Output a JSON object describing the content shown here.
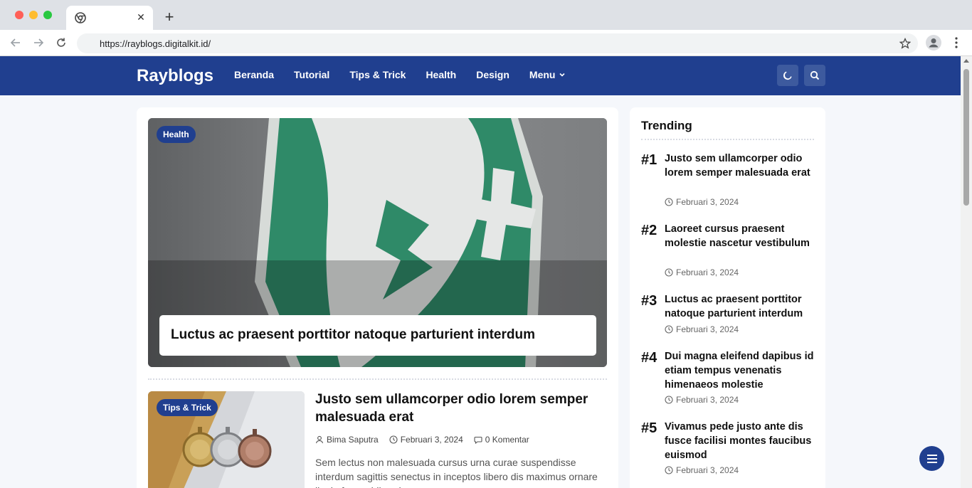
{
  "browser": {
    "url": "https://rayblogs.digitalkit.id/"
  },
  "site": {
    "logo": "Rayblogs",
    "menu": [
      {
        "label": "Beranda"
      },
      {
        "label": "Tutorial"
      },
      {
        "label": "Tips & Trick"
      },
      {
        "label": "Health"
      },
      {
        "label": "Design"
      },
      {
        "label": "Menu"
      }
    ]
  },
  "hero": {
    "badge": "Health",
    "title": "Luctus ac praesent porttitor natoque parturient interdum"
  },
  "post": {
    "badge": "Tips & Trick",
    "title": "Justo sem ullamcorper odio lorem semper malesuada erat",
    "author": "Bima Saputra",
    "date": "Februari 3, 2024",
    "comments": "0 Komentar",
    "excerpt": "Sem lectus non malesuada cursus urna curae suspendisse interdum sagittis senectus in inceptos libero dis maximus ornare ligula fames bibendum"
  },
  "trending": {
    "title": "Trending",
    "items": [
      {
        "rank": "#1",
        "title": "Justo sem ullamcorper odio lorem semper malesuada erat",
        "date": "Februari 3, 2024"
      },
      {
        "rank": "#2",
        "title": "Laoreet cursus praesent molestie nascetur vestibulum",
        "date": "Februari 3, 2024"
      },
      {
        "rank": "#3",
        "title": "Luctus ac praesent porttitor natoque parturient interdum",
        "date": "Februari 3, 2024"
      },
      {
        "rank": "#4",
        "title": "Dui magna eleifend dapibus id etiam tempus venenatis himenaeos molestie",
        "date": "Februari 3, 2024"
      },
      {
        "rank": "#5",
        "title": "Vivamus pede justo ante dis fusce facilisi montes faucibus euismod",
        "date": "Februari 3, 2024"
      }
    ]
  },
  "colors": {
    "brand": "#203f8f",
    "header_button": "#3d5a9e"
  }
}
